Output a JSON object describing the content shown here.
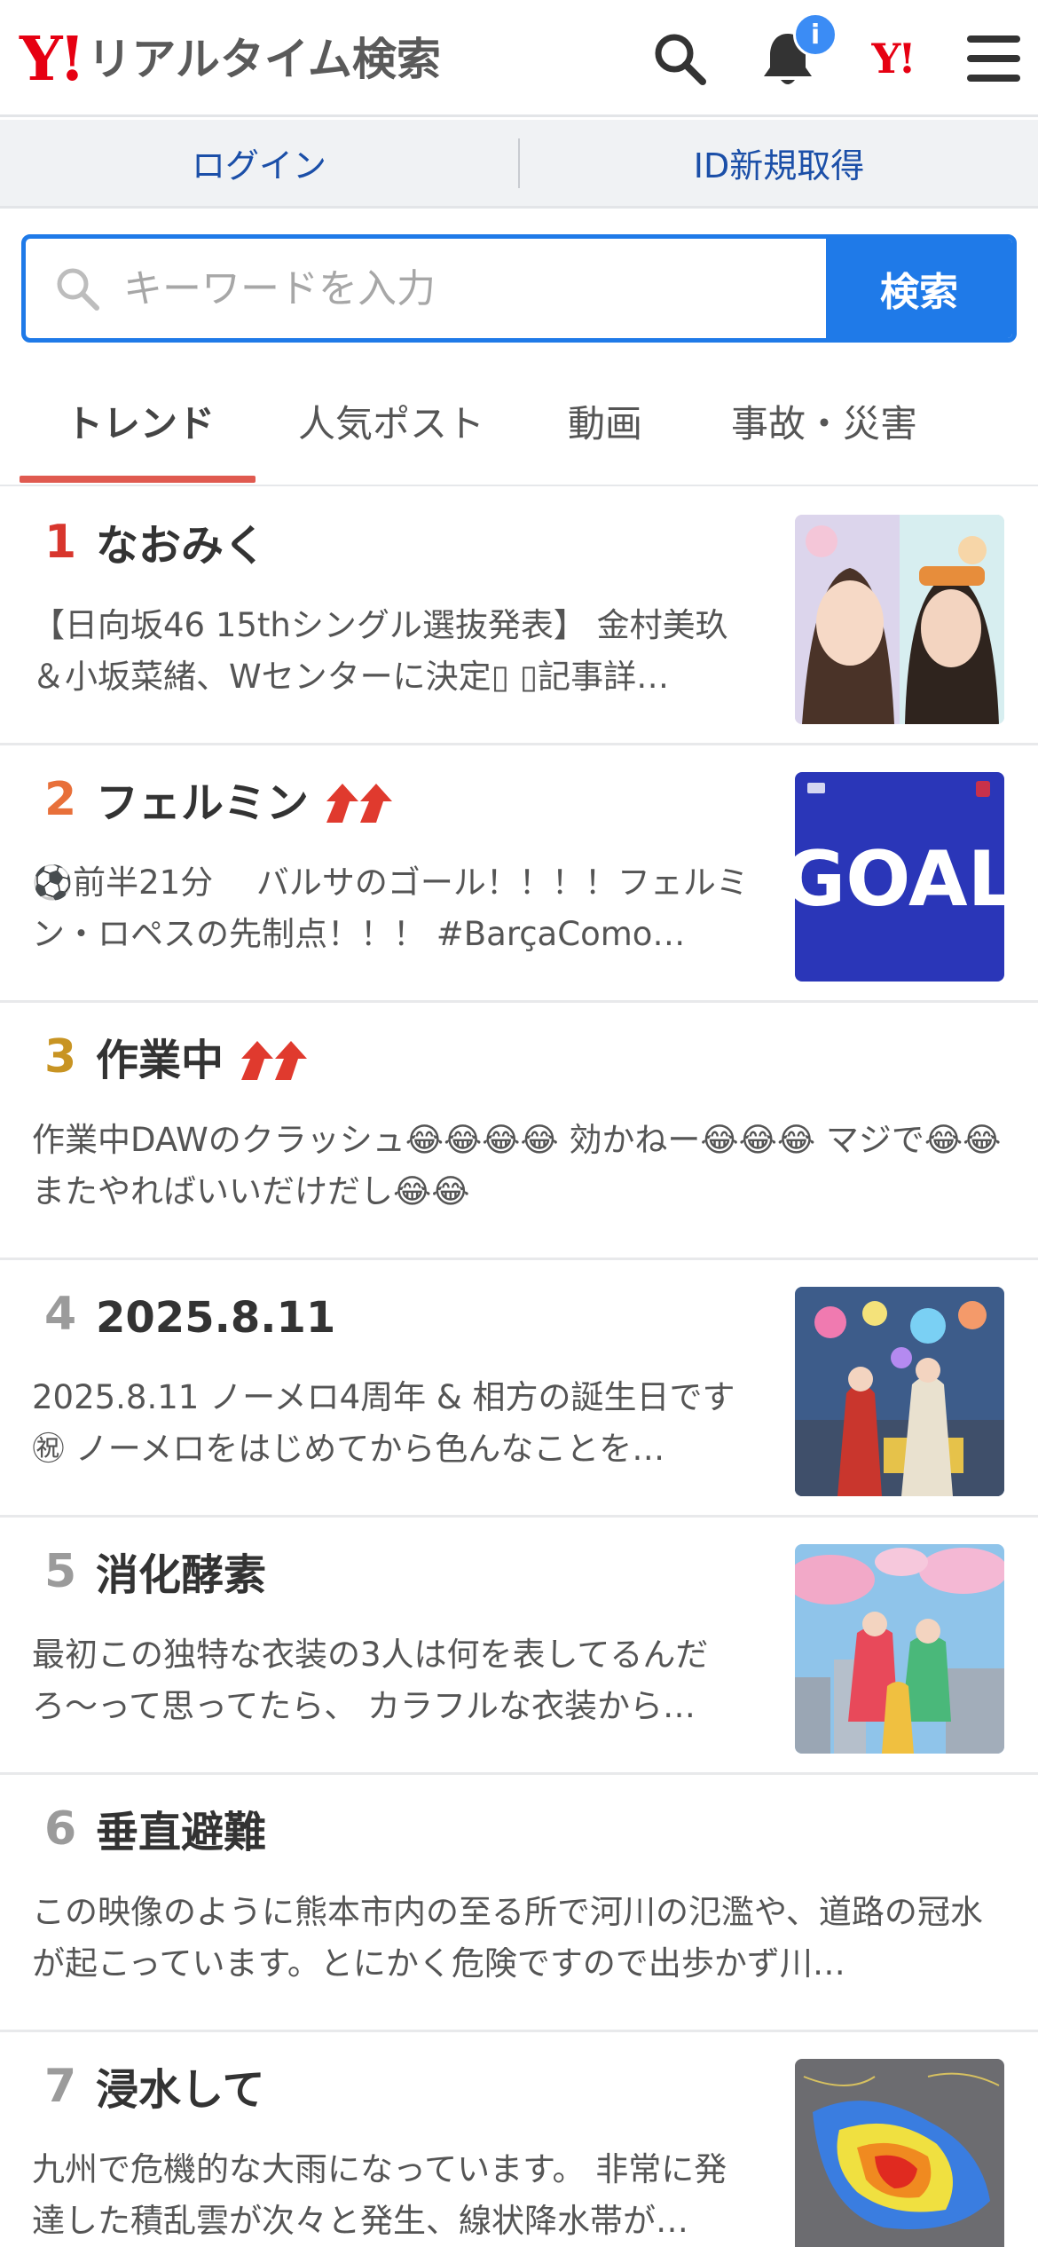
{
  "header": {
    "logo_mark": "Y!",
    "logo_text": "リアルタイム検索",
    "notification_badge": "i",
    "yj_mark": "Y!"
  },
  "login_bar": {
    "login": "ログイン",
    "register": "ID新規取得"
  },
  "search": {
    "placeholder": "キーワードを入力",
    "button": "検索"
  },
  "tabs": [
    "トレンド",
    "人気ポスト",
    "動画",
    "事故・災害"
  ],
  "active_tab": "トレンド",
  "colors": {
    "accent_blue": "#1f7ae8",
    "brand_red": "#e60012",
    "rank1": "#d8362d",
    "rank2": "#e8703a",
    "rank3": "#c89423",
    "rank_other": "#9b9b9b",
    "tab_underline": "#e05a50"
  },
  "trends": [
    {
      "rank": "1",
      "title": "なおみく",
      "rising": false,
      "desc": "【日向坂46 15thシングル選抜発表】 金村美玖＆小坂菜緒、Wセンターに決定▯ ▯記事詳…",
      "thumb": "portrait-photo"
    },
    {
      "rank": "2",
      "title": "フェルミン",
      "rising": true,
      "desc": "⚽前半21分　 バルサのゴール！！！！フェルミン・ロペスの先制点！！！ #BarçaComo…",
      "thumb": "goal-graphic",
      "thumb_text": "GOAL"
    },
    {
      "rank": "3",
      "title": "作業中",
      "rising": true,
      "desc": "作業中DAWのクラッシュ😂😂😂😂 効かねー😂😂😂 マジで😂😂 またやればいいだけだし😂😂",
      "thumb": null
    },
    {
      "rank": "4",
      "title": "2025.8.11",
      "rising": false,
      "desc": "2025.8.11 ノーメロ4周年 & 相方の誕生日です㊗ ノーメロをはじめてから色んなことを…",
      "thumb": "stage-photo"
    },
    {
      "rank": "5",
      "title": "消化酵素",
      "rising": false,
      "desc": "最初この独特な衣装の3人は何を表してるんだろ〜って思ってたら、 カラフルな衣装から…",
      "thumb": "city-photo"
    },
    {
      "rank": "6",
      "title": "垂直避難",
      "rising": false,
      "desc": "この映像のように熊本市内の至る所で河川の氾濫や、道路の冠水が起こっています。とにかく危険ですので出歩かず川…",
      "thumb": null
    },
    {
      "rank": "7",
      "title": "浸水して",
      "rising": false,
      "desc": "九州で危機的な大雨になっています。 非常に発達した積乱雲が次々と発生、線状降水帯が…",
      "thumb": "rain-radar-map"
    }
  ]
}
